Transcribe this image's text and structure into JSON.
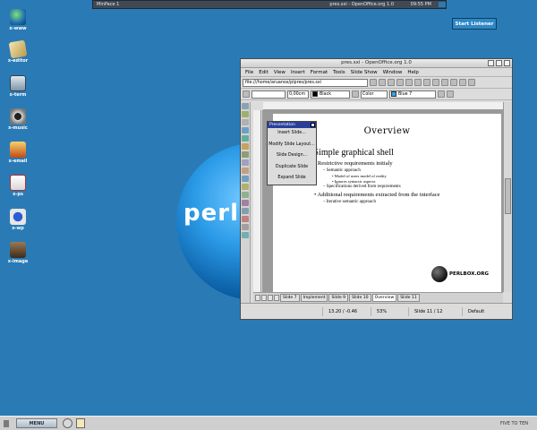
{
  "topbar": {
    "workspace": "MinPace 1",
    "window_title": "pres.sxi - OpenOffice.org 1.0",
    "clock": "09:55 PM"
  },
  "listener_button": "Start Listener",
  "desktop_icons": [
    {
      "label": "x-www",
      "icon": "globe-icon"
    },
    {
      "label": "x-editor",
      "icon": "notepad-icon"
    },
    {
      "label": "x-term",
      "icon": "terminal-icon"
    },
    {
      "label": "x-music",
      "icon": "cd-icon"
    },
    {
      "label": "x-email",
      "icon": "mail-icon"
    },
    {
      "label": "x-ps",
      "icon": "pdf-icon"
    },
    {
      "label": "x-wp",
      "icon": "word-processor-icon"
    },
    {
      "label": "x-image",
      "icon": "gimp-icon"
    }
  ],
  "wallpaper_logo": "perlb",
  "window": {
    "title": "pres.sxi - OpenOffice.org 1.0",
    "menu": [
      "File",
      "Edit",
      "View",
      "Insert",
      "Format",
      "Tools",
      "Slide Show",
      "Window",
      "Help"
    ],
    "url": "file:///home/aruanox/plpres/pres.sxi",
    "line_width": "0,00cm",
    "line_color": "Black",
    "area_style": "Color",
    "area_color": "Blue 7",
    "colors": {
      "black": "#000000",
      "blue7": "#2fa4e7"
    }
  },
  "popup": {
    "title": "Presentation",
    "items": [
      "Insert Slide...",
      "Modify Slide Layout...",
      "Slide Design...",
      "Duplicate Slide",
      "Expand Slide"
    ]
  },
  "slide": {
    "title": "Overview",
    "partial_heading": "n:",
    "l1": "Simple graphical shell",
    "b1": "Restrictive requirements initialy",
    "b1_sub": "Semantic approach",
    "b1_sub_a": "Model of users model of reality",
    "b1_sub_b": "Ignores syntactic aspects",
    "b1_sub2": "Specifications derived from requirements",
    "b2": "Additional requirements extracted from the interface",
    "b2_sub": "Iterative semantic approach",
    "logo": "PERLBOX.ORG"
  },
  "slide_tabs": [
    "Slide 7",
    "Implement",
    "Slide 9",
    "Slide 10",
    "Overview",
    "Slide 11"
  ],
  "active_tab": "Overview",
  "status": {
    "position": "13.20 / -0.46",
    "zoom": "53%",
    "slide": "Slide 11 / 12",
    "layout": "Default"
  },
  "taskbar": {
    "menu": "MENU",
    "clock": "FIVE TO TEN"
  }
}
